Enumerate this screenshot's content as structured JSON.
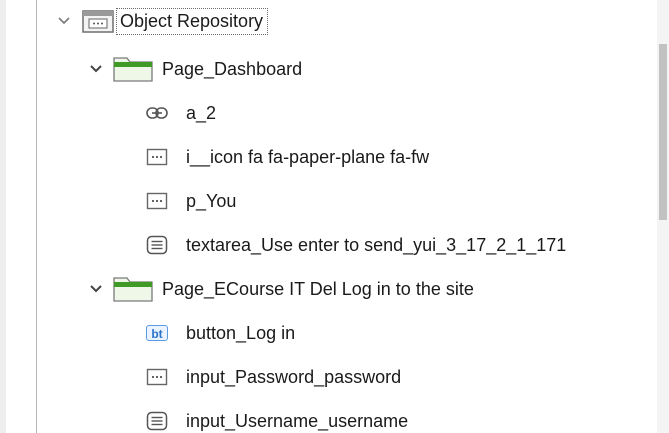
{
  "tree": {
    "root": {
      "label": "Object Repository",
      "icon": "repository-icon"
    },
    "folders": [
      {
        "label": "Page_Dashboard",
        "icon": "folder-icon",
        "items": [
          {
            "label": "a_2",
            "icon": "link-icon"
          },
          {
            "label": "i__icon fa fa-paper-plane fa-fw",
            "icon": "element-icon"
          },
          {
            "label": "p_You",
            "icon": "element-icon"
          },
          {
            "label": "textarea_Use enter to send_yui_3_17_2_1_171",
            "icon": "textarea-icon"
          }
        ]
      },
      {
        "label": "Page_ECourse IT Del Log in to the site",
        "icon": "folder-icon",
        "items": [
          {
            "label": "button_Log in",
            "icon": "button-icon",
            "badge": "bt"
          },
          {
            "label": "input_Password_password",
            "icon": "element-icon"
          },
          {
            "label": "input_Username_username",
            "icon": "textarea-icon"
          }
        ]
      }
    ]
  },
  "colors": {
    "folder_tab": "#3f9a26",
    "folder_body": "#eef7e8",
    "badge_blue": "#2b74c9",
    "text": "#1a1a1a"
  }
}
